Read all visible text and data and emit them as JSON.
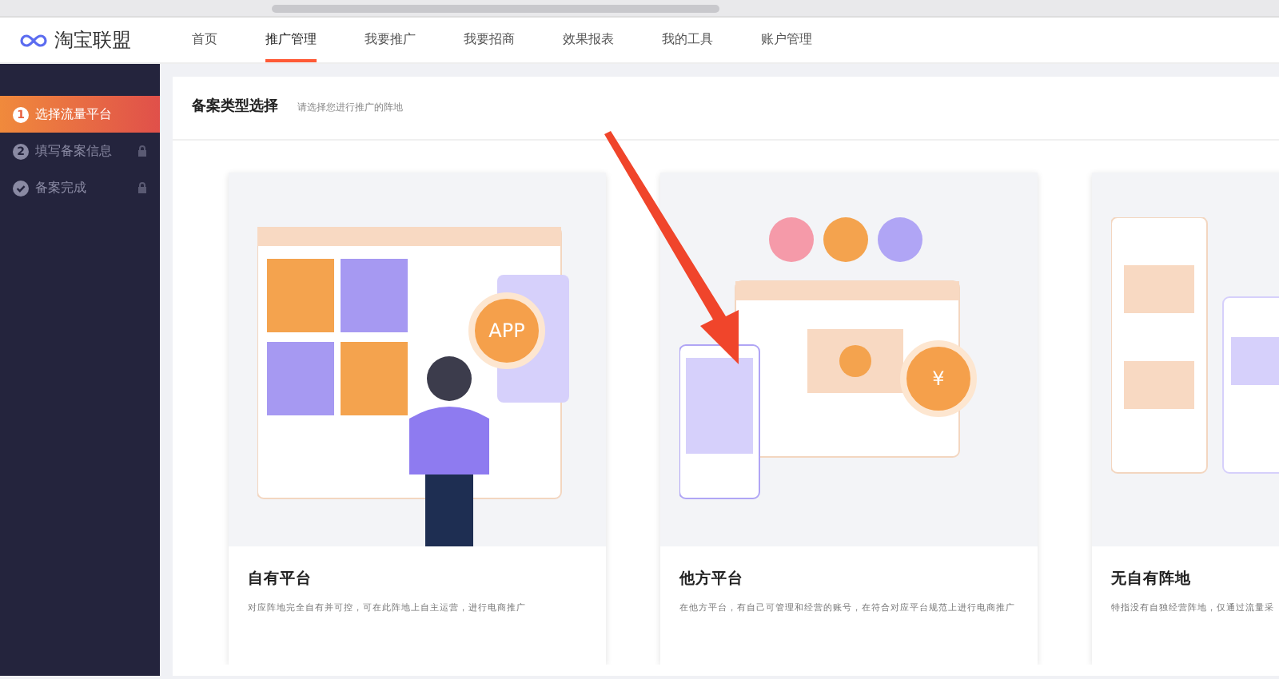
{
  "logo": {
    "name": "淘宝联盟"
  },
  "nav": [
    {
      "label": "首页",
      "selected": false
    },
    {
      "label": "推广管理",
      "selected": true
    },
    {
      "label": "我要推广",
      "selected": false
    },
    {
      "label": "我要招商",
      "selected": false
    },
    {
      "label": "效果报表",
      "selected": false
    },
    {
      "label": "我的工具",
      "selected": false
    },
    {
      "label": "账户管理",
      "selected": false
    }
  ],
  "steps": [
    {
      "number": "1",
      "label": "选择流量平台",
      "selected": true,
      "locked": false,
      "kind": "number"
    },
    {
      "number": "2",
      "label": "填写备案信息",
      "selected": false,
      "locked": true,
      "kind": "number"
    },
    {
      "label": "备案完成",
      "selected": false,
      "locked": true,
      "kind": "check"
    }
  ],
  "header": {
    "title": "备案类型选择",
    "subtitle": "请选择您进行推广的阵地"
  },
  "cards": [
    {
      "title": "自有平台",
      "description": "对应阵地完全自有并可控，可在此阵地上自主运营，进行电商推广",
      "kind": "own",
      "badge": "APP"
    },
    {
      "title": "他方平台",
      "description": "在他方平台，有自己可管理和经营的账号，在符合对应平台规范上进行电商推广",
      "kind": "other",
      "badge": "¥"
    },
    {
      "title": "无自有阵地",
      "description": "特指没有自独经营阵地，仅通过流量采",
      "kind": "none"
    }
  ]
}
